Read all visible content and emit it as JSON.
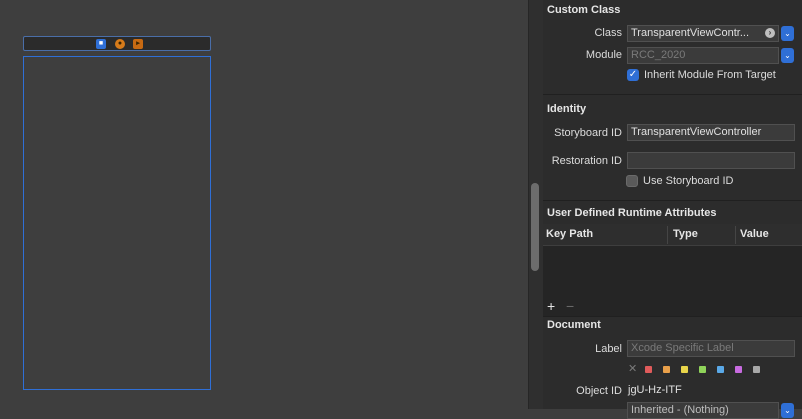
{
  "inspector": {
    "custom_class": {
      "title": "Custom Class",
      "class_label": "Class",
      "class_value": "TransparentViewContr...",
      "module_label": "Module",
      "module_placeholder": "RCC_2020",
      "inherit_label": "Inherit Module From Target",
      "inherit_checked": true
    },
    "identity": {
      "title": "Identity",
      "storyboard_id_label": "Storyboard ID",
      "storyboard_id_value": "TransparentViewController",
      "restoration_id_label": "Restoration ID",
      "restoration_id_value": "",
      "use_storyboard_id_label": "Use Storyboard ID",
      "use_storyboard_id_checked": false
    },
    "runtime_attributes": {
      "title": "User Defined Runtime Attributes",
      "columns": [
        "Key Path",
        "Type",
        "Value"
      ],
      "add_label": "+",
      "remove_label": "−"
    },
    "document": {
      "title": "Document",
      "label_label": "Label",
      "label_placeholder": "Xcode Specific Label",
      "no_color_glyph": "✕",
      "label_colors": [
        "#e05b5b",
        "#e9a04a",
        "#e8d54a",
        "#8fd35a",
        "#5aa9e8",
        "#c86be0",
        "#a8a8a8"
      ],
      "object_id_label": "Object ID",
      "object_id_value": "jgU-Hz-ITF",
      "lock_value": "Inherited - (Nothing)"
    }
  },
  "canvas": {
    "scene_icons": [
      "view-controller-icon",
      "first-responder-icon",
      "exit-icon"
    ]
  }
}
